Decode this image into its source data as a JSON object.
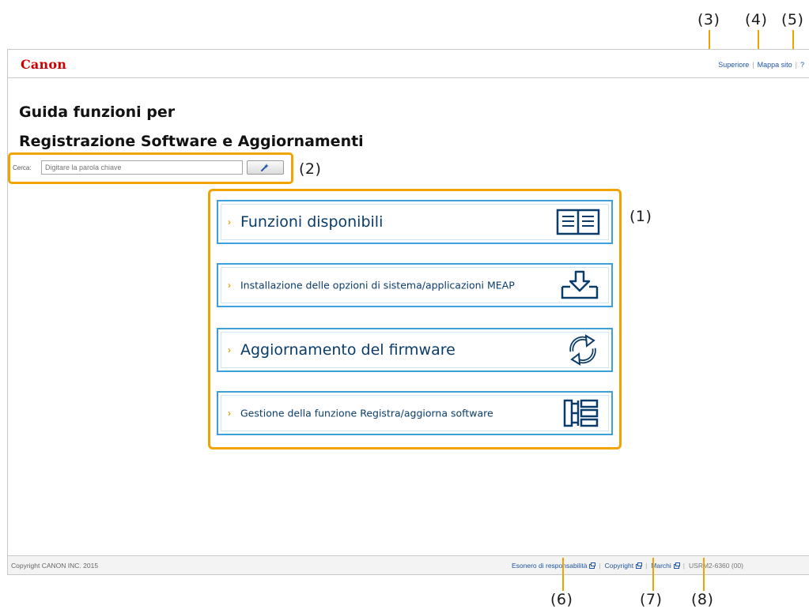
{
  "callouts": {
    "c1": "(1)",
    "c2": "(2)",
    "c3": "(3)",
    "c4": "(4)",
    "c5": "(5)",
    "c6": "(6)",
    "c7": "(7)",
    "c8": "(8)"
  },
  "header": {
    "logo": "Canon",
    "links": {
      "top": "Superiore",
      "sitemap": "Mappa sito",
      "help": "?"
    }
  },
  "page": {
    "title_line1": "Guida funzioni per",
    "title_line2": "Registrazione Software e Aggiornamenti"
  },
  "search": {
    "label": "Cerca:",
    "placeholder": "Digitare la parola chiave",
    "button_icon": "search-icon"
  },
  "cards": [
    {
      "label": "Funzioni disponibili",
      "icon": "book-icon"
    },
    {
      "label": "Installazione delle opzioni di sistema/applicazioni MEAP",
      "icon": "download-tray-icon"
    },
    {
      "label": "Aggiornamento del firmware",
      "icon": "refresh-arrows-icon"
    },
    {
      "label": "Gestione della funzione Registra/aggiorna software",
      "icon": "tree-structure-icon"
    }
  ],
  "footer": {
    "copyright": "Copyright CANON INC. 2015",
    "disclaimer": "Esonero di responsabilità",
    "copyright_link": "Copyright",
    "trademarks": "Marchi",
    "code": "USRM2-6360 (00)"
  },
  "colors": {
    "accent": "#f0a400",
    "card_border": "#3ba0dc",
    "card_text": "#0a3c6b",
    "logo": "#cc0000"
  }
}
